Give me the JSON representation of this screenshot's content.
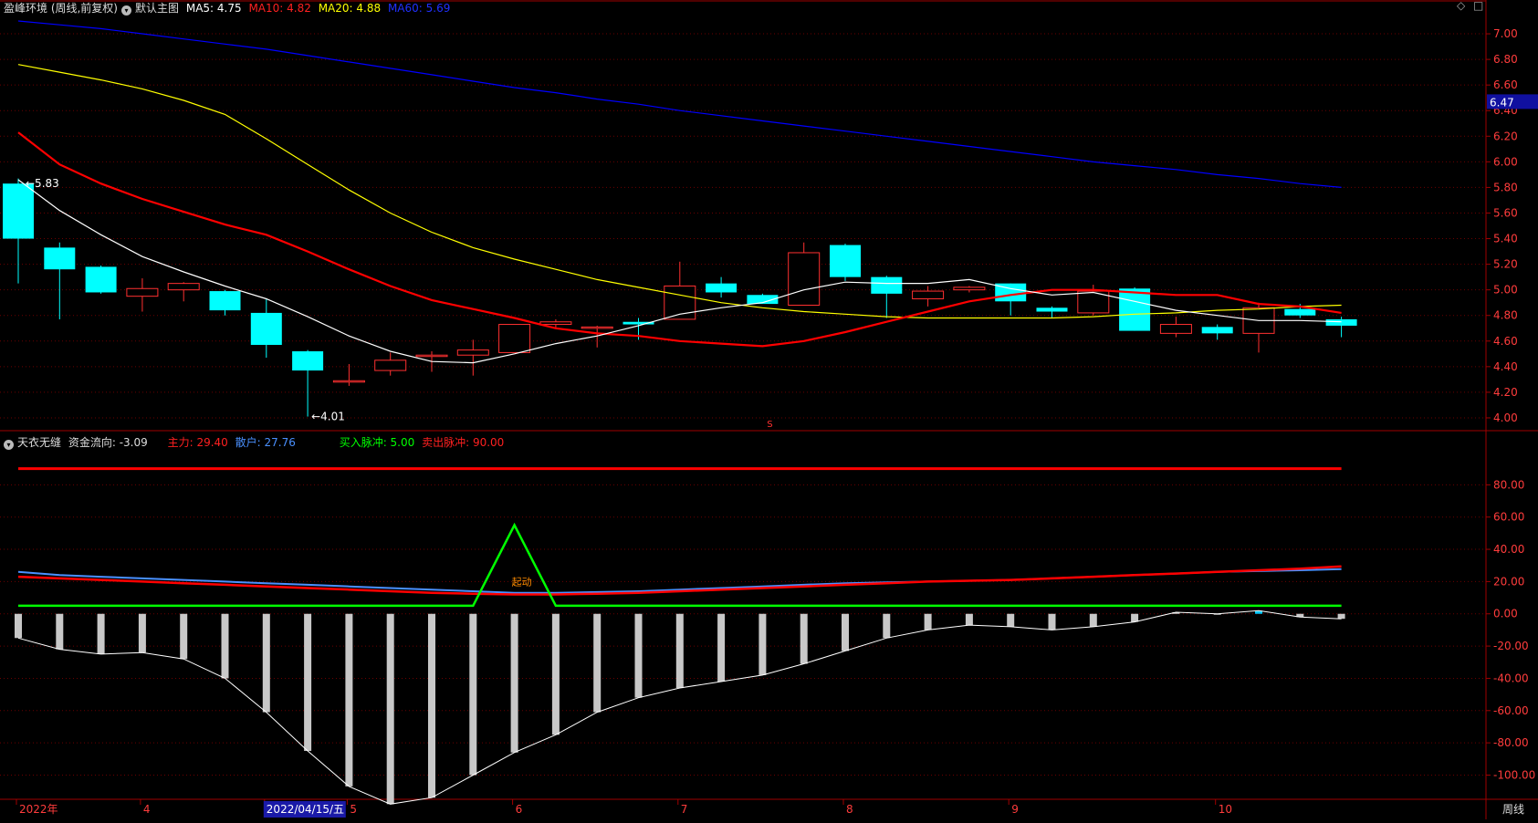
{
  "colors": {
    "bg": "#000000",
    "grid": "#6b0000",
    "axis": "#a00000",
    "up": "#ff3030",
    "down": "#00ffff",
    "ma5": "#ffffff",
    "ma10": "#ff0000",
    "ma20": "#ffff00",
    "ma60": "#0000ff",
    "main_force": "#ff0000",
    "retail": "#4a90ff",
    "pulse": "#00ff00",
    "sell_pulse": "#ff0000",
    "bars": "#c8c8c8"
  },
  "header_main": {
    "title": "盈峰环境 (周线,前复权)",
    "indicator": "默认主图",
    "ma5": "MA5: 4.75",
    "ma10": "MA10: 4.82",
    "ma20": "MA20: 4.88",
    "ma60": "MA60: 5.69"
  },
  "header_sub": {
    "indicator": "天衣无缝",
    "flow": "资金流向: -3.09",
    "main_force": "主力: 29.40",
    "retail": "散户: 27.76",
    "buy_pulse": "买入脉冲: 5.00",
    "sell_pulse": "卖出脉冲: 90.00"
  },
  "price_axis": [
    "7.00",
    "6.80",
    "6.60",
    "6.40",
    "6.20",
    "6.00",
    "5.80",
    "5.60",
    "5.40",
    "5.20",
    "5.00",
    "4.80",
    "4.60",
    "4.40",
    "4.20",
    "4.00"
  ],
  "price_marker": "6.47",
  "high_label": "5.83",
  "low_label": "4.01",
  "s_marker": "S",
  "sub_axis": [
    "80.00",
    "60.00",
    "40.00",
    "20.00",
    "0.00",
    "-20.00",
    "-40.00",
    "-60.00",
    "-80.00",
    "-100.00"
  ],
  "signal_label": "起动",
  "date_axis": {
    "labels": [
      "2022年",
      "4",
      "2022/04/15/五",
      "5",
      "6",
      "7",
      "8",
      "9",
      "10"
    ],
    "period": "周线"
  },
  "corner_icons": [
    "diamond-icon",
    "square-icon"
  ],
  "chart_data": [
    {
      "type": "candlestick",
      "title": "盈峰环境 (周线,前复权)",
      "ylim": [
        3.9,
        7.15
      ],
      "candles": [
        {
          "o": 5.83,
          "h": 5.87,
          "l": 5.05,
          "c": 5.4
        },
        {
          "o": 5.33,
          "h": 5.37,
          "l": 4.77,
          "c": 5.16
        },
        {
          "o": 5.18,
          "h": 5.19,
          "l": 4.97,
          "c": 4.98
        },
        {
          "o": 4.95,
          "h": 5.09,
          "l": 4.83,
          "c": 5.01
        },
        {
          "o": 5.0,
          "h": 5.06,
          "l": 4.91,
          "c": 5.05
        },
        {
          "o": 4.99,
          "h": 5.0,
          "l": 4.8,
          "c": 4.84
        },
        {
          "o": 4.82,
          "h": 4.93,
          "l": 4.47,
          "c": 4.57
        },
        {
          "o": 4.52,
          "h": 4.53,
          "l": 4.01,
          "c": 4.37
        },
        {
          "o": 4.29,
          "h": 4.42,
          "l": 4.25,
          "c": 4.29
        },
        {
          "o": 4.37,
          "h": 4.51,
          "l": 4.33,
          "c": 4.45
        },
        {
          "o": 4.49,
          "h": 4.52,
          "l": 4.36,
          "c": 4.49
        },
        {
          "o": 4.49,
          "h": 4.61,
          "l": 4.33,
          "c": 4.53
        },
        {
          "o": 4.51,
          "h": 4.73,
          "l": 4.51,
          "c": 4.73
        },
        {
          "o": 4.73,
          "h": 4.77,
          "l": 4.7,
          "c": 4.75
        },
        {
          "o": 4.7,
          "h": 4.72,
          "l": 4.55,
          "c": 4.71
        },
        {
          "o": 4.75,
          "h": 4.78,
          "l": 4.61,
          "c": 4.73
        },
        {
          "o": 4.77,
          "h": 5.22,
          "l": 4.77,
          "c": 5.03
        },
        {
          "o": 5.05,
          "h": 5.1,
          "l": 4.94,
          "c": 4.98
        },
        {
          "o": 4.96,
          "h": 4.97,
          "l": 4.91,
          "c": 4.89
        },
        {
          "o": 4.88,
          "h": 5.37,
          "l": 4.88,
          "c": 5.29
        },
        {
          "o": 5.35,
          "h": 5.36,
          "l": 5.07,
          "c": 5.1
        },
        {
          "o": 5.1,
          "h": 5.11,
          "l": 4.78,
          "c": 4.97
        },
        {
          "o": 4.93,
          "h": 5.03,
          "l": 4.87,
          "c": 4.99
        },
        {
          "o": 5.0,
          "h": 5.03,
          "l": 4.98,
          "c": 5.02
        },
        {
          "o": 5.05,
          "h": 5.05,
          "l": 4.8,
          "c": 4.91
        },
        {
          "o": 4.86,
          "h": 4.87,
          "l": 4.78,
          "c": 4.83
        },
        {
          "o": 4.82,
          "h": 5.04,
          "l": 4.8,
          "c": 4.99
        },
        {
          "o": 5.01,
          "h": 5.02,
          "l": 4.68,
          "c": 4.68
        },
        {
          "o": 4.66,
          "h": 4.79,
          "l": 4.63,
          "c": 4.73
        },
        {
          "o": 4.71,
          "h": 4.73,
          "l": 4.61,
          "c": 4.66
        },
        {
          "o": 4.66,
          "h": 4.9,
          "l": 4.51,
          "c": 4.86
        },
        {
          "o": 4.85,
          "h": 4.89,
          "l": 4.78,
          "c": 4.8
        },
        {
          "o": 4.77,
          "h": 4.79,
          "l": 4.63,
          "c": 4.72
        }
      ],
      "ma5": [
        5.86,
        5.62,
        5.43,
        5.26,
        5.14,
        5.03,
        4.93,
        4.79,
        4.64,
        4.52,
        4.44,
        4.43,
        4.5,
        4.58,
        4.64,
        4.72,
        4.81,
        4.86,
        4.9,
        5.0,
        5.06,
        5.05,
        5.05,
        5.08,
        5.01,
        4.96,
        4.98,
        4.91,
        4.84,
        4.8,
        4.76,
        4.76,
        4.75
      ],
      "ma10": [
        6.23,
        5.98,
        5.83,
        5.71,
        5.61,
        5.51,
        5.43,
        5.3,
        5.16,
        5.03,
        4.92,
        4.85,
        4.78,
        4.7,
        4.66,
        4.64,
        4.6,
        4.58,
        4.56,
        4.6,
        4.67,
        4.75,
        4.83,
        4.91,
        4.96,
        5.0,
        5.0,
        4.98,
        4.96,
        4.96,
        4.89,
        4.87,
        4.82
      ],
      "ma20": [
        6.76,
        6.7,
        6.64,
        6.57,
        6.48,
        6.37,
        6.18,
        5.98,
        5.78,
        5.6,
        5.45,
        5.33,
        5.24,
        5.16,
        5.08,
        5.02,
        4.96,
        4.9,
        4.86,
        4.83,
        4.81,
        4.79,
        4.78,
        4.78,
        4.78,
        4.78,
        4.79,
        4.81,
        4.82,
        4.84,
        4.85,
        4.87,
        4.88
      ],
      "ma60": [
        7.1,
        7.07,
        7.04,
        7.0,
        6.96,
        6.92,
        6.88,
        6.83,
        6.78,
        6.73,
        6.68,
        6.63,
        6.58,
        6.54,
        6.49,
        6.45,
        6.4,
        6.36,
        6.32,
        6.28,
        6.24,
        6.2,
        6.16,
        6.12,
        6.08,
        6.04,
        6.0,
        5.97,
        5.94,
        5.9,
        5.87,
        5.83,
        5.8
      ]
    },
    {
      "type": "line",
      "title": "天衣无缝",
      "ylim": [
        -115,
        100
      ],
      "sell_pulse": 90,
      "buy_pulse_base": 5,
      "buy_pulse_peak": {
        "index": 12,
        "value": 55
      },
      "main_force": [
        23,
        22,
        21,
        20,
        19,
        18,
        17,
        16,
        15,
        14,
        13,
        12.5,
        12,
        12,
        12.5,
        13,
        14,
        15,
        16,
        17,
        18,
        19,
        20,
        20.5,
        21,
        22,
        23,
        24,
        25,
        26,
        27,
        28,
        29.4
      ],
      "retail": [
        26,
        24,
        23,
        22,
        21,
        20,
        19,
        18,
        17,
        16,
        15,
        14,
        13,
        13,
        13.5,
        14,
        15,
        16,
        17,
        18,
        19,
        19.5,
        20,
        20.5,
        21,
        22,
        23,
        24,
        25,
        26,
        26.5,
        27,
        27.76
      ],
      "flow_bars": [
        -15,
        -22,
        -25,
        -24,
        -28,
        -40,
        -61,
        -85,
        -107,
        -118,
        -114,
        -100,
        -86,
        -75,
        -61,
        -52,
        -46,
        -42,
        -38,
        -31,
        -23,
        -15,
        -10,
        -7,
        -8,
        -10,
        -8,
        -5,
        1,
        0,
        2,
        -2,
        -3.09
      ]
    }
  ]
}
